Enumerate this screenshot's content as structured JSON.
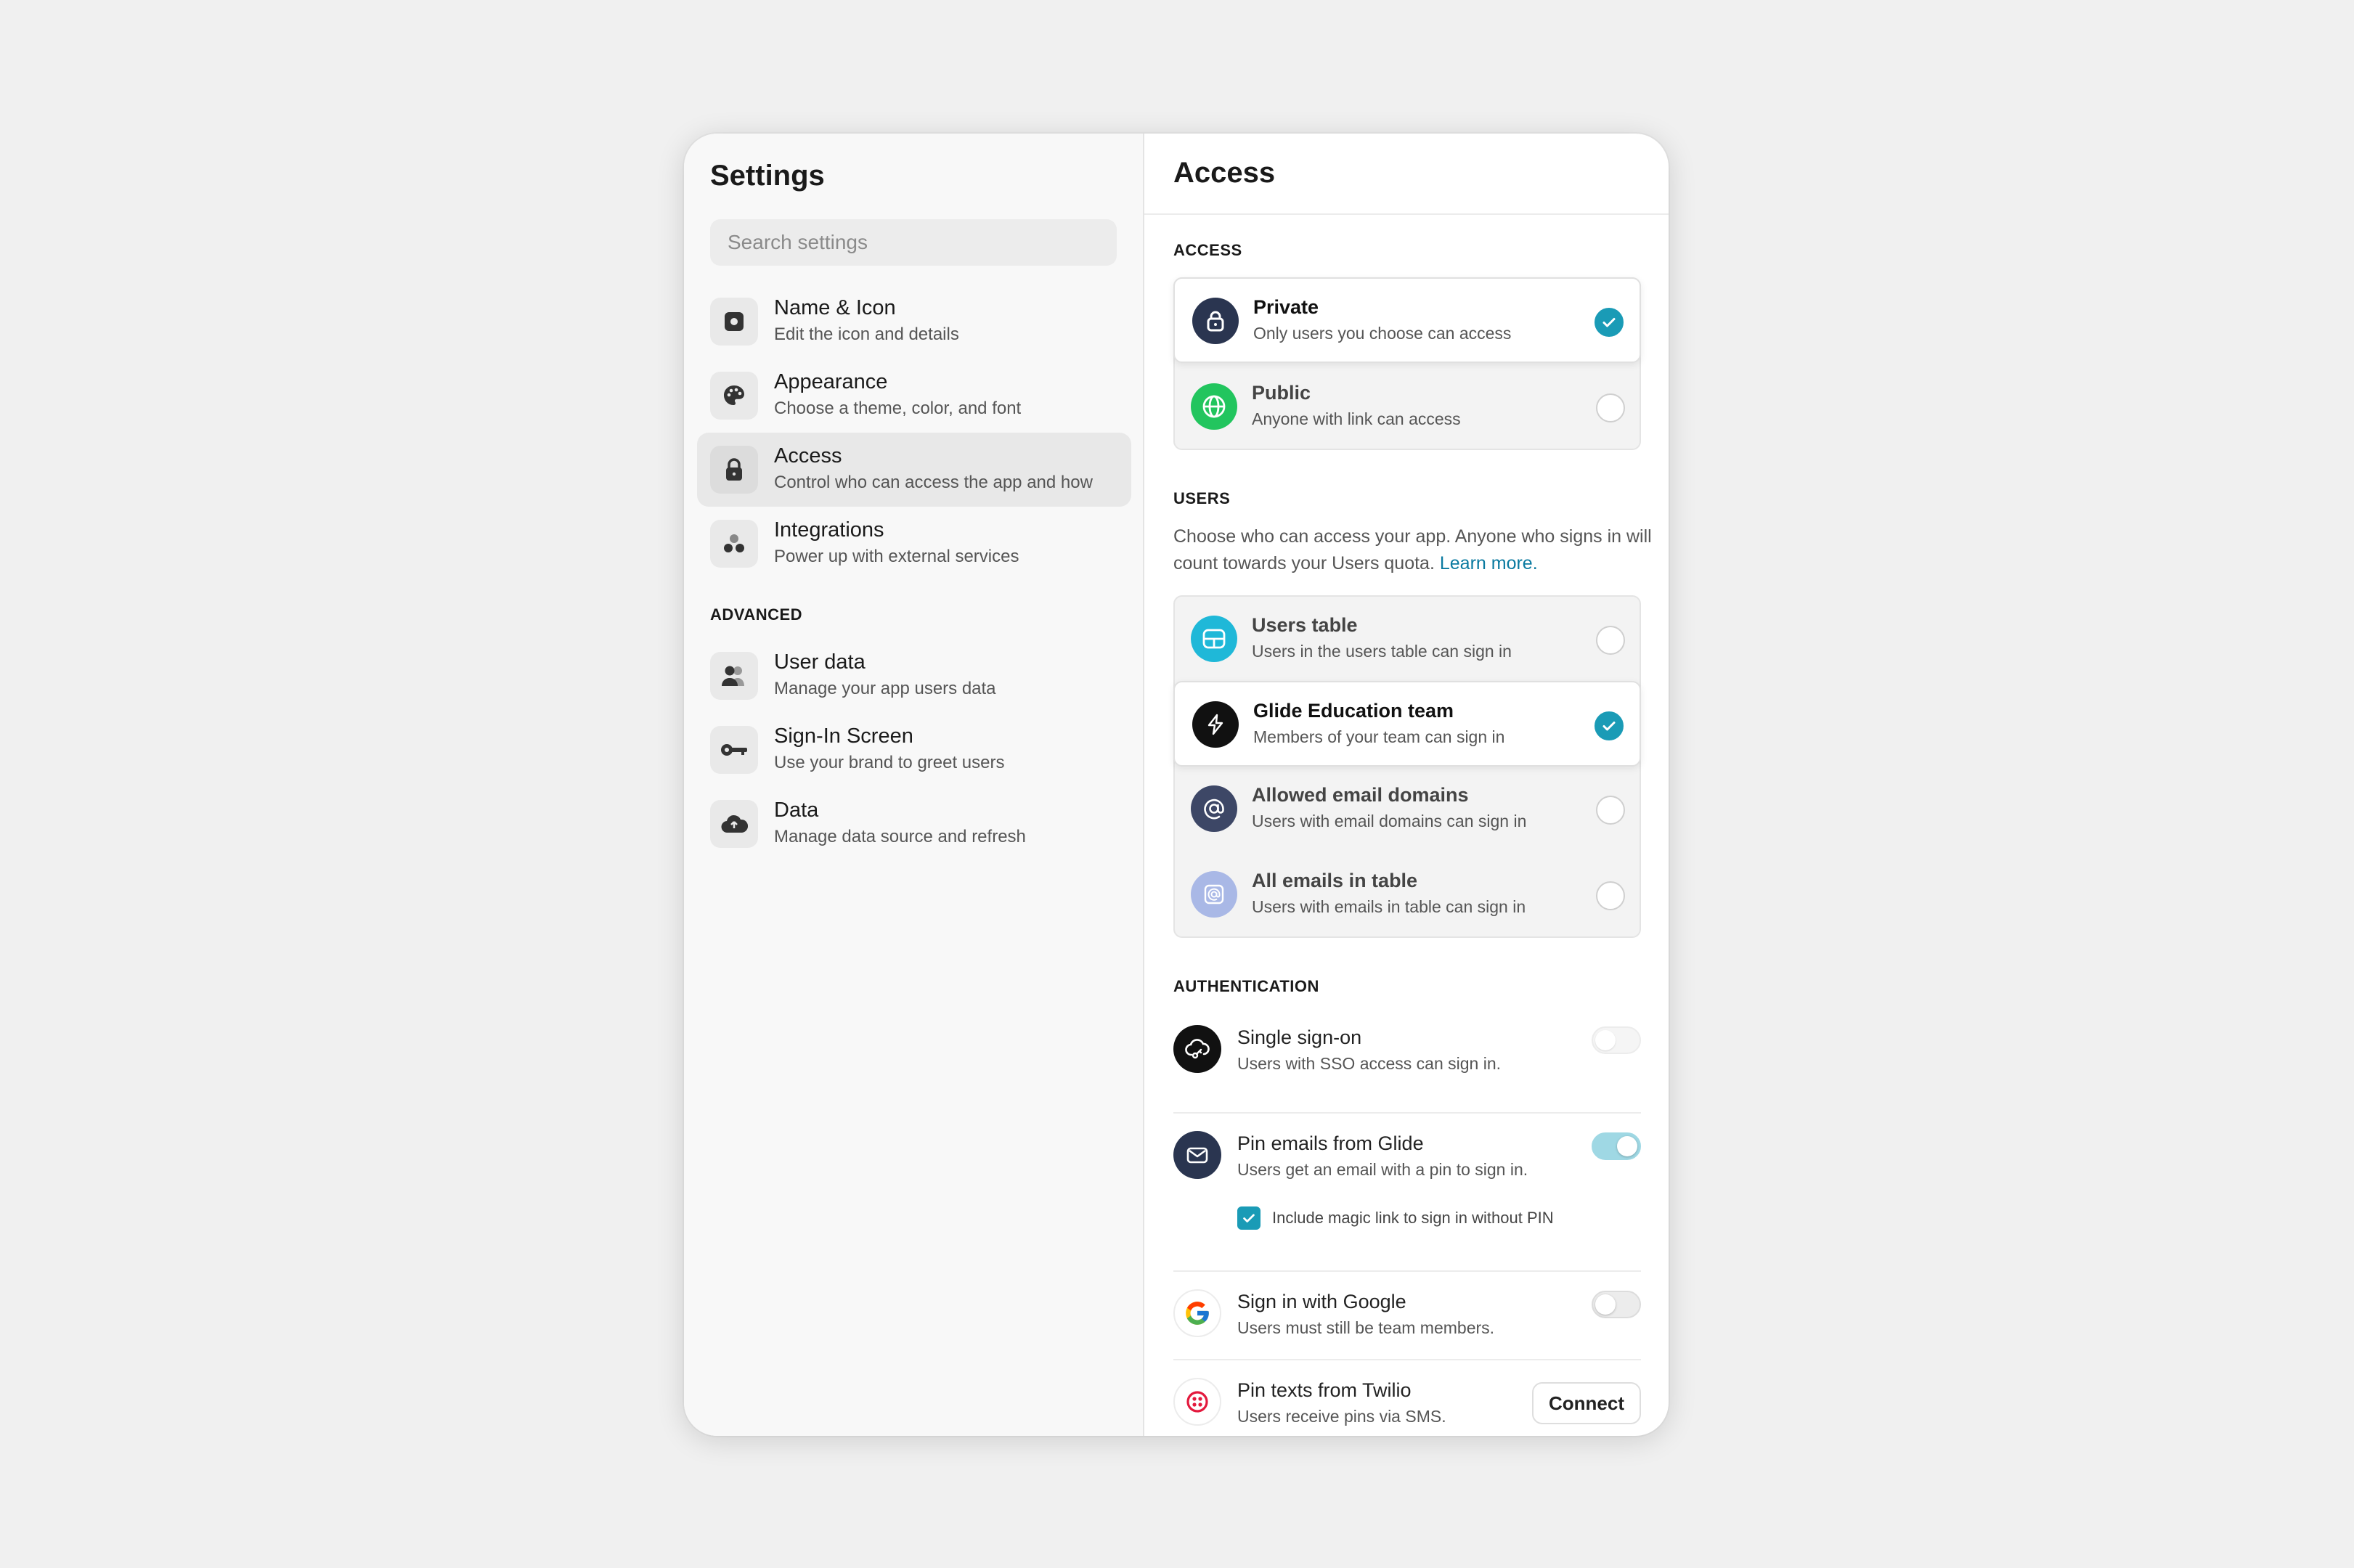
{
  "sidebar": {
    "title": "Settings",
    "search_placeholder": "Search settings",
    "items": [
      {
        "label": "Name & Icon",
        "sub": "Edit the icon and details"
      },
      {
        "label": "Appearance",
        "sub": "Choose a theme, color, and font"
      },
      {
        "label": "Access",
        "sub": "Control who can access the app and how",
        "active": true
      },
      {
        "label": "Integrations",
        "sub": "Power up with external services"
      }
    ],
    "advanced_label": "ADVANCED",
    "advanced_items": [
      {
        "label": "User data",
        "sub": "Manage your app users data"
      },
      {
        "label": "Sign-In Screen",
        "sub": "Use your brand to greet users"
      },
      {
        "label": "Data",
        "sub": "Manage data source and refresh"
      }
    ]
  },
  "main": {
    "title": "Access",
    "access_section": {
      "label": "ACCESS",
      "options": [
        {
          "label": "Private",
          "sub": "Only users you choose can access",
          "selected": true,
          "icon": "lock-icon"
        },
        {
          "label": "Public",
          "sub": "Anyone with link can access",
          "selected": false,
          "icon": "globe-icon"
        }
      ]
    },
    "users_section": {
      "label": "USERS",
      "description": "Choose who can access your app. Anyone who signs in will count towards your Users quota.",
      "learn_more": "Learn more.",
      "options": [
        {
          "label": "Users table",
          "sub": "Users in the users table can sign in",
          "selected": false,
          "icon": "table-icon"
        },
        {
          "label": "Glide Education team",
          "sub": "Members of your team can sign in",
          "selected": true,
          "icon": "glide-logo-icon"
        },
        {
          "label": "Allowed email domains",
          "sub": "Users with email domains can sign in",
          "selected": false,
          "icon": "at-sign-icon"
        },
        {
          "label": "All emails in table",
          "sub": "Users with emails in table can sign in",
          "selected": false,
          "icon": "email-table-icon"
        }
      ]
    },
    "auth_section": {
      "label": "AUTHENTICATION",
      "sso": {
        "label": "Single sign-on",
        "sub": "Users with SSO access can sign in.",
        "enabled": false
      },
      "pin_email": {
        "label": "Pin emails from Glide",
        "sub": "Users get an email with a pin to sign in.",
        "enabled": true
      },
      "magic_link": {
        "label": "Include magic link to sign in without PIN",
        "checked": true
      },
      "google": {
        "label": "Sign in with Google",
        "sub": "Users must still be team members.",
        "enabled": false
      },
      "twilio": {
        "label": "Pin texts from Twilio",
        "sub": "Users receive pins via SMS.",
        "button": "Connect"
      }
    }
  },
  "colors": {
    "accent": "#1a9bb6",
    "private_icon_bg": "#2a3550",
    "public_icon_bg": "#22c55e",
    "users_table_icon_bg": "#1fb8d8",
    "domains_icon_bg": "#3d4766",
    "emails_table_icon_bg": "#a9b8e6",
    "twilio_red": "#e3193d"
  }
}
